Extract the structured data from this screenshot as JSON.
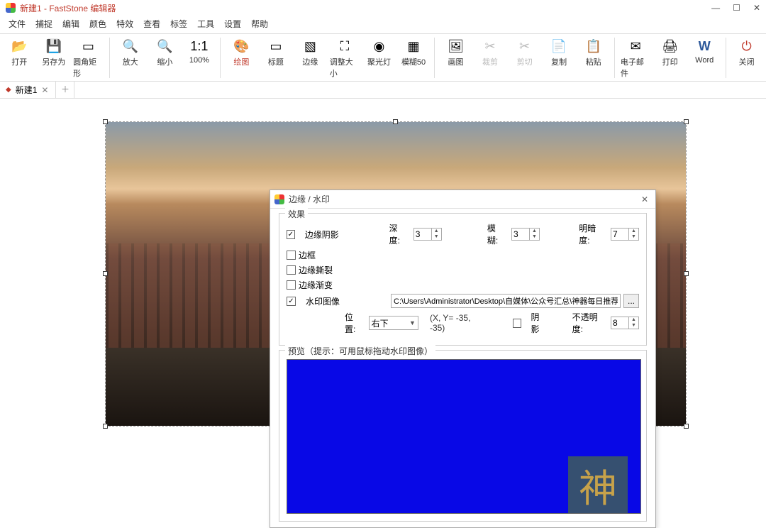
{
  "window": {
    "title": "新建1 - FastStone 编辑器"
  },
  "menu": [
    "文件",
    "捕捉",
    "编辑",
    "颜色",
    "特效",
    "查看",
    "标签",
    "工具",
    "设置",
    "帮助"
  ],
  "toolbar": [
    {
      "label": "打开",
      "icon": "📂",
      "group": 0
    },
    {
      "label": "另存为",
      "icon": "💾",
      "group": 0
    },
    {
      "label": "圆角矩形",
      "icon": "▭",
      "group": 0
    },
    {
      "label": "放大",
      "icon": "🔍",
      "group": 1
    },
    {
      "label": "缩小",
      "icon": "🔍",
      "group": 1
    },
    {
      "label": "100%",
      "icon": "1:1",
      "group": 1
    },
    {
      "label": "绘图",
      "icon": "🎨",
      "group": 2,
      "accent": true
    },
    {
      "label": "标题",
      "icon": "▭",
      "group": 2
    },
    {
      "label": "边缘",
      "icon": "▧",
      "group": 2
    },
    {
      "label": "调整大小",
      "icon": "⛶",
      "group": 2
    },
    {
      "label": "聚光灯",
      "icon": "◉",
      "group": 2
    },
    {
      "label": "模糊50",
      "icon": "▦",
      "group": 2
    },
    {
      "label": "画图",
      "icon": "🖼",
      "group": 3
    },
    {
      "label": "裁剪",
      "icon": "✂",
      "group": 3,
      "disabled": true
    },
    {
      "label": "剪切",
      "icon": "✂",
      "group": 3,
      "disabled": true
    },
    {
      "label": "复制",
      "icon": "📄",
      "group": 3
    },
    {
      "label": "粘贴",
      "icon": "📋",
      "group": 3
    },
    {
      "label": "电子邮件",
      "icon": "✉",
      "group": 4
    },
    {
      "label": "打印",
      "icon": "🖨",
      "group": 4
    },
    {
      "label": "Word",
      "icon": "W",
      "group": 4
    },
    {
      "label": "关闭",
      "icon": "⏻",
      "group": 5
    }
  ],
  "tab": {
    "name": "新建1"
  },
  "dialog": {
    "title": "边缘 / 水印",
    "effects_legend": "效果",
    "edge_shadow": {
      "label": "边缘阴影",
      "checked": true
    },
    "depth": {
      "label": "深度:",
      "value": "3"
    },
    "blur": {
      "label": "模糊:",
      "value": "3"
    },
    "brightness": {
      "label": "明暗度:",
      "value": "7"
    },
    "border": {
      "label": "边框",
      "checked": false
    },
    "edge_tear": {
      "label": "边缘撕裂",
      "checked": false
    },
    "edge_fade": {
      "label": "边缘渐变",
      "checked": false
    },
    "watermark": {
      "label": "水印图像",
      "checked": true
    },
    "path": "C:\\Users\\Administrator\\Desktop\\自媒体\\公众号汇总\\神器每日推荐\\神器小图",
    "browse": "...",
    "position_label": "位置:",
    "position_value": "右下",
    "coords": "(X, Y= -35, -35)",
    "shadow_chk": {
      "label": "阴影",
      "checked": false
    },
    "opacity": {
      "label": "不透明度:",
      "value": "8"
    },
    "preview_legend": "预览（提示：可用鼠标拖动水印图像）",
    "watermark_char": "神"
  }
}
